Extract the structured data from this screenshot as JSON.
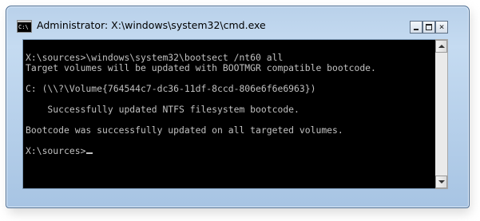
{
  "window": {
    "title": "Administrator: X:\\windows\\system32\\cmd.exe",
    "icon_label": "C:\\"
  },
  "controls": {
    "minimize": "minimize-icon",
    "maximize": "maximize-icon",
    "close": "×"
  },
  "console": {
    "lines": [
      "X:\\sources>\\windows\\system32\\bootsect /nt60 all",
      "Target volumes will be updated with BOOTMGR compatible bootcode.",
      "",
      "C: (\\\\?\\Volume{764544c7-dc36-11df-8ccd-806e6f6e6963})",
      "",
      "    Successfully updated NTFS filesystem bootcode.",
      "",
      "Bootcode was successfully updated on all targeted volumes.",
      "",
      "X:\\sources>"
    ]
  },
  "colors": {
    "console_bg": "#000000",
    "console_text": "#c0c0c0",
    "frame": "#b9d1ea"
  }
}
